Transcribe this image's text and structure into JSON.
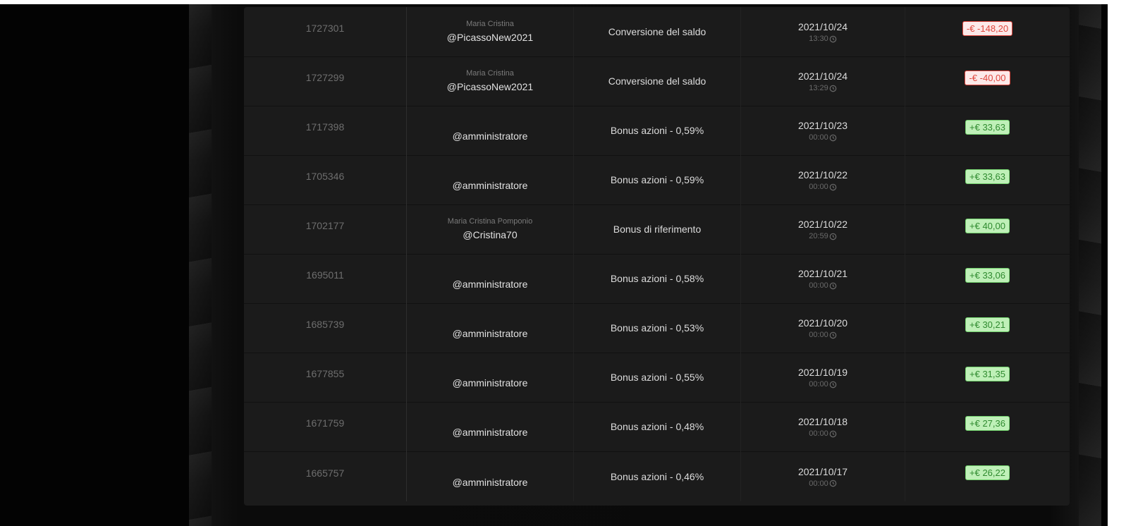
{
  "colors": {
    "negative_text": "#e0463d",
    "negative_bg": "#fce9e9",
    "positive_text": "#2f8a2f",
    "positive_bg": "#bff0b8",
    "card_bg": "#1b1b1b"
  },
  "transactions": [
    {
      "id": "1727301",
      "name": "Maria Cristina",
      "handle": "@PicassoNew2021",
      "type": "Conversione del saldo",
      "date": "2021/10/24",
      "time": "13:30",
      "amount": "-€ -148,20",
      "sign": "neg"
    },
    {
      "id": "1727299",
      "name": "Maria Cristina",
      "handle": "@PicassoNew2021",
      "type": "Conversione del saldo",
      "date": "2021/10/24",
      "time": "13:29",
      "amount": "-€ -40,00",
      "sign": "neg"
    },
    {
      "id": "1717398",
      "name": "",
      "handle": "@amministratore",
      "type": "Bonus azioni - 0,59%",
      "date": "2021/10/23",
      "time": "00:00",
      "amount": "+€ 33,63",
      "sign": "pos"
    },
    {
      "id": "1705346",
      "name": "",
      "handle": "@amministratore",
      "type": "Bonus azioni - 0,59%",
      "date": "2021/10/22",
      "time": "00:00",
      "amount": "+€ 33,63",
      "sign": "pos"
    },
    {
      "id": "1702177",
      "name": "Maria Cristina Pomponio",
      "handle": "@Cristina70",
      "type": "Bonus di riferimento",
      "date": "2021/10/22",
      "time": "20:59",
      "amount": "+€ 40,00",
      "sign": "pos"
    },
    {
      "id": "1695011",
      "name": "",
      "handle": "@amministratore",
      "type": "Bonus azioni - 0,58%",
      "date": "2021/10/21",
      "time": "00:00",
      "amount": "+€ 33,06",
      "sign": "pos"
    },
    {
      "id": "1685739",
      "name": "",
      "handle": "@amministratore",
      "type": "Bonus azioni - 0,53%",
      "date": "2021/10/20",
      "time": "00:00",
      "amount": "+€ 30,21",
      "sign": "pos"
    },
    {
      "id": "1677855",
      "name": "",
      "handle": "@amministratore",
      "type": "Bonus azioni - 0,55%",
      "date": "2021/10/19",
      "time": "00:00",
      "amount": "+€ 31,35",
      "sign": "pos"
    },
    {
      "id": "1671759",
      "name": "",
      "handle": "@amministratore",
      "type": "Bonus azioni - 0,48%",
      "date": "2021/10/18",
      "time": "00:00",
      "amount": "+€ 27,36",
      "sign": "pos"
    },
    {
      "id": "1665757",
      "name": "",
      "handle": "@amministratore",
      "type": "Bonus azioni - 0,46%",
      "date": "2021/10/17",
      "time": "00:00",
      "amount": "+€ 26,22",
      "sign": "pos"
    }
  ]
}
